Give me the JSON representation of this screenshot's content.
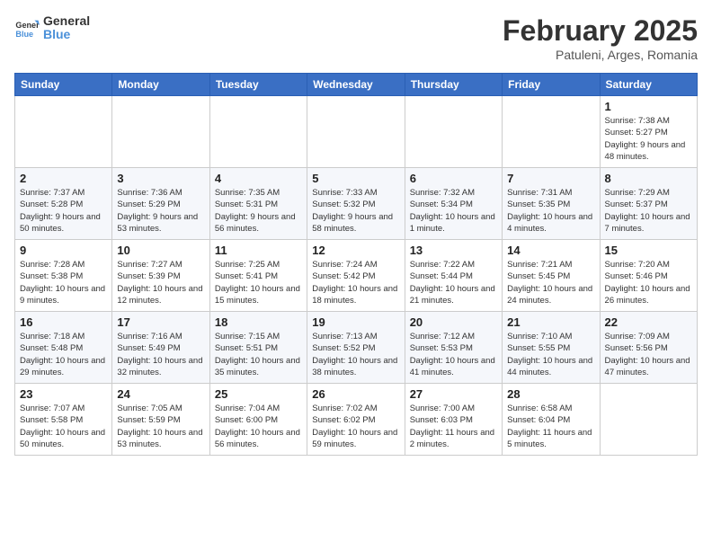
{
  "logo": {
    "line1": "General",
    "line2": "Blue"
  },
  "header": {
    "title": "February 2025",
    "subtitle": "Patuleni, Arges, Romania"
  },
  "weekdays": [
    "Sunday",
    "Monday",
    "Tuesday",
    "Wednesday",
    "Thursday",
    "Friday",
    "Saturday"
  ],
  "weeks": [
    [
      {
        "day": "",
        "info": ""
      },
      {
        "day": "",
        "info": ""
      },
      {
        "day": "",
        "info": ""
      },
      {
        "day": "",
        "info": ""
      },
      {
        "day": "",
        "info": ""
      },
      {
        "day": "",
        "info": ""
      },
      {
        "day": "1",
        "info": "Sunrise: 7:38 AM\nSunset: 5:27 PM\nDaylight: 9 hours and 48 minutes."
      }
    ],
    [
      {
        "day": "2",
        "info": "Sunrise: 7:37 AM\nSunset: 5:28 PM\nDaylight: 9 hours and 50 minutes."
      },
      {
        "day": "3",
        "info": "Sunrise: 7:36 AM\nSunset: 5:29 PM\nDaylight: 9 hours and 53 minutes."
      },
      {
        "day": "4",
        "info": "Sunrise: 7:35 AM\nSunset: 5:31 PM\nDaylight: 9 hours and 56 minutes."
      },
      {
        "day": "5",
        "info": "Sunrise: 7:33 AM\nSunset: 5:32 PM\nDaylight: 9 hours and 58 minutes."
      },
      {
        "day": "6",
        "info": "Sunrise: 7:32 AM\nSunset: 5:34 PM\nDaylight: 10 hours and 1 minute."
      },
      {
        "day": "7",
        "info": "Sunrise: 7:31 AM\nSunset: 5:35 PM\nDaylight: 10 hours and 4 minutes."
      },
      {
        "day": "8",
        "info": "Sunrise: 7:29 AM\nSunset: 5:37 PM\nDaylight: 10 hours and 7 minutes."
      }
    ],
    [
      {
        "day": "9",
        "info": "Sunrise: 7:28 AM\nSunset: 5:38 PM\nDaylight: 10 hours and 9 minutes."
      },
      {
        "day": "10",
        "info": "Sunrise: 7:27 AM\nSunset: 5:39 PM\nDaylight: 10 hours and 12 minutes."
      },
      {
        "day": "11",
        "info": "Sunrise: 7:25 AM\nSunset: 5:41 PM\nDaylight: 10 hours and 15 minutes."
      },
      {
        "day": "12",
        "info": "Sunrise: 7:24 AM\nSunset: 5:42 PM\nDaylight: 10 hours and 18 minutes."
      },
      {
        "day": "13",
        "info": "Sunrise: 7:22 AM\nSunset: 5:44 PM\nDaylight: 10 hours and 21 minutes."
      },
      {
        "day": "14",
        "info": "Sunrise: 7:21 AM\nSunset: 5:45 PM\nDaylight: 10 hours and 24 minutes."
      },
      {
        "day": "15",
        "info": "Sunrise: 7:20 AM\nSunset: 5:46 PM\nDaylight: 10 hours and 26 minutes."
      }
    ],
    [
      {
        "day": "16",
        "info": "Sunrise: 7:18 AM\nSunset: 5:48 PM\nDaylight: 10 hours and 29 minutes."
      },
      {
        "day": "17",
        "info": "Sunrise: 7:16 AM\nSunset: 5:49 PM\nDaylight: 10 hours and 32 minutes."
      },
      {
        "day": "18",
        "info": "Sunrise: 7:15 AM\nSunset: 5:51 PM\nDaylight: 10 hours and 35 minutes."
      },
      {
        "day": "19",
        "info": "Sunrise: 7:13 AM\nSunset: 5:52 PM\nDaylight: 10 hours and 38 minutes."
      },
      {
        "day": "20",
        "info": "Sunrise: 7:12 AM\nSunset: 5:53 PM\nDaylight: 10 hours and 41 minutes."
      },
      {
        "day": "21",
        "info": "Sunrise: 7:10 AM\nSunset: 5:55 PM\nDaylight: 10 hours and 44 minutes."
      },
      {
        "day": "22",
        "info": "Sunrise: 7:09 AM\nSunset: 5:56 PM\nDaylight: 10 hours and 47 minutes."
      }
    ],
    [
      {
        "day": "23",
        "info": "Sunrise: 7:07 AM\nSunset: 5:58 PM\nDaylight: 10 hours and 50 minutes."
      },
      {
        "day": "24",
        "info": "Sunrise: 7:05 AM\nSunset: 5:59 PM\nDaylight: 10 hours and 53 minutes."
      },
      {
        "day": "25",
        "info": "Sunrise: 7:04 AM\nSunset: 6:00 PM\nDaylight: 10 hours and 56 minutes."
      },
      {
        "day": "26",
        "info": "Sunrise: 7:02 AM\nSunset: 6:02 PM\nDaylight: 10 hours and 59 minutes."
      },
      {
        "day": "27",
        "info": "Sunrise: 7:00 AM\nSunset: 6:03 PM\nDaylight: 11 hours and 2 minutes."
      },
      {
        "day": "28",
        "info": "Sunrise: 6:58 AM\nSunset: 6:04 PM\nDaylight: 11 hours and 5 minutes."
      },
      {
        "day": "",
        "info": ""
      }
    ]
  ]
}
